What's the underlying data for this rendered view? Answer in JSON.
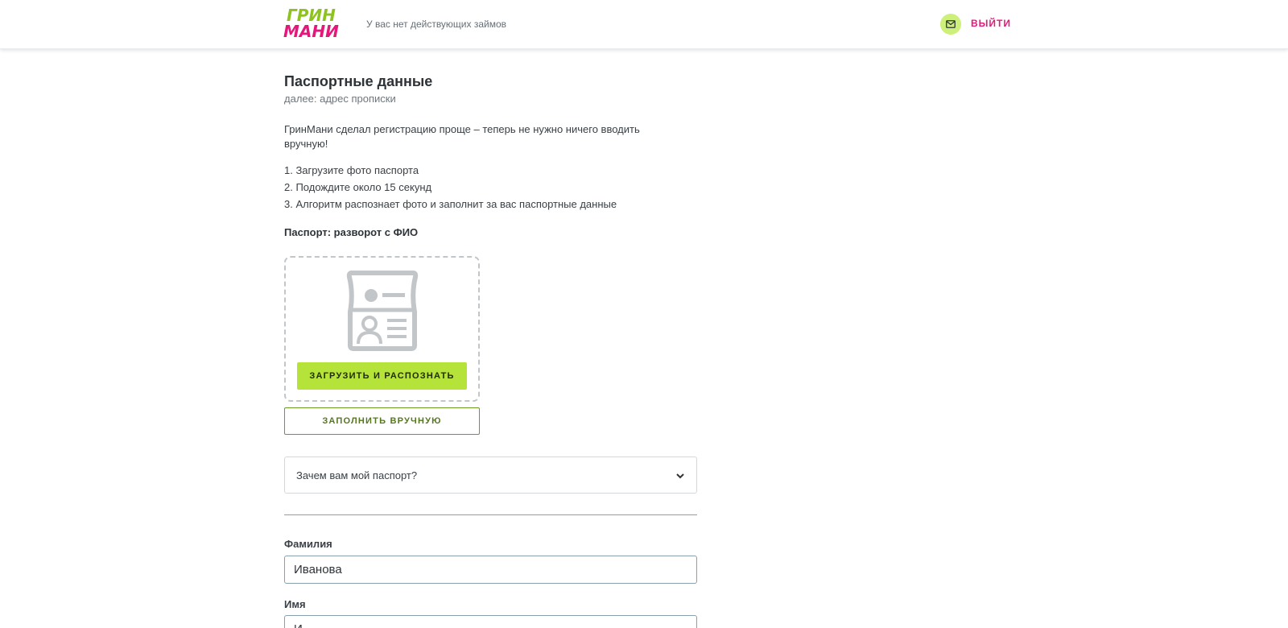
{
  "header": {
    "logo_line1": "ГРИН",
    "logo_line2": "МАНИ",
    "status_text": "У вас нет действующих займов",
    "logout_label": "ВЫЙТИ"
  },
  "page": {
    "title": "Паспортные данные",
    "subtitle": "далее: адрес прописки",
    "intro": "ГринМани сделал регистрацию проще – теперь не нужно ничего вводить вручную!",
    "steps": [
      "1. Загрузите фото паспорта",
      "2. Подождите около 15 секунд",
      "3. Алгоритм распознает фото и заполнит за вас паспортные данные"
    ],
    "upload_label": "Паспорт: разворот с ФИО",
    "upload_button": "ЗАГРУЗИТЬ И РАСПОЗНАТЬ",
    "manual_button": "ЗАПОЛНИТЬ ВРУЧНУЮ",
    "faq_question": "Зачем вам мой паспорт?"
  },
  "form": {
    "surname_label": "Фамилия",
    "surname_value": "Иванова",
    "name_label": "Имя",
    "name_value": "И"
  },
  "icons": [
    "mail-icon",
    "passport-icon",
    "chevron-down-icon"
  ],
  "colors": {
    "brand_green": "#8ec31f",
    "brand_pink": "#e5177a",
    "button_green": "#b6e33a",
    "outline_green": "#6e9a27"
  }
}
